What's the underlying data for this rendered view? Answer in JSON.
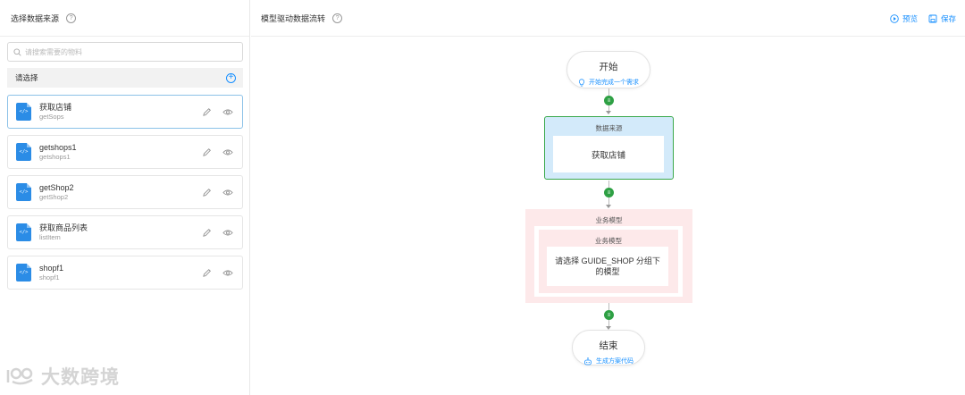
{
  "left": {
    "title": "选择数据来源",
    "help": "?",
    "search_placeholder": "请搜索需要的物料",
    "select_label": "请选择",
    "items": [
      {
        "name": "获取店铺",
        "id": "getSops",
        "selected": true
      },
      {
        "name": "getshops1",
        "id": "getshops1",
        "selected": false
      },
      {
        "name": "getShop2",
        "id": "getShop2",
        "selected": false
      },
      {
        "name": "获取商品列表",
        "id": "listItem",
        "selected": false
      },
      {
        "name": "shopf1",
        "id": "shopf1",
        "selected": false
      }
    ],
    "file_icon_glyph": "</>"
  },
  "right": {
    "title": "模型驱动数据流转",
    "help": "?",
    "preview_label": "预览",
    "save_label": "保存"
  },
  "flow": {
    "start_title": "开始",
    "start_sub": "开始完成一个需求",
    "datasource_title": "数据来源",
    "datasource_value": "获取店铺",
    "business_outer_title": "业务模型",
    "business_inner_title": "业务模型",
    "business_prompt": "请选择 GUIDE_SHOP 分组下的模型",
    "end_title": "结束",
    "end_sub": "生成方案代码"
  },
  "watermark": "大数跨境",
  "colors": {
    "accent": "#1890ff",
    "success": "#2ea044",
    "datasource_bg": "#d3eafa",
    "business_bg": "#fde9ea"
  }
}
